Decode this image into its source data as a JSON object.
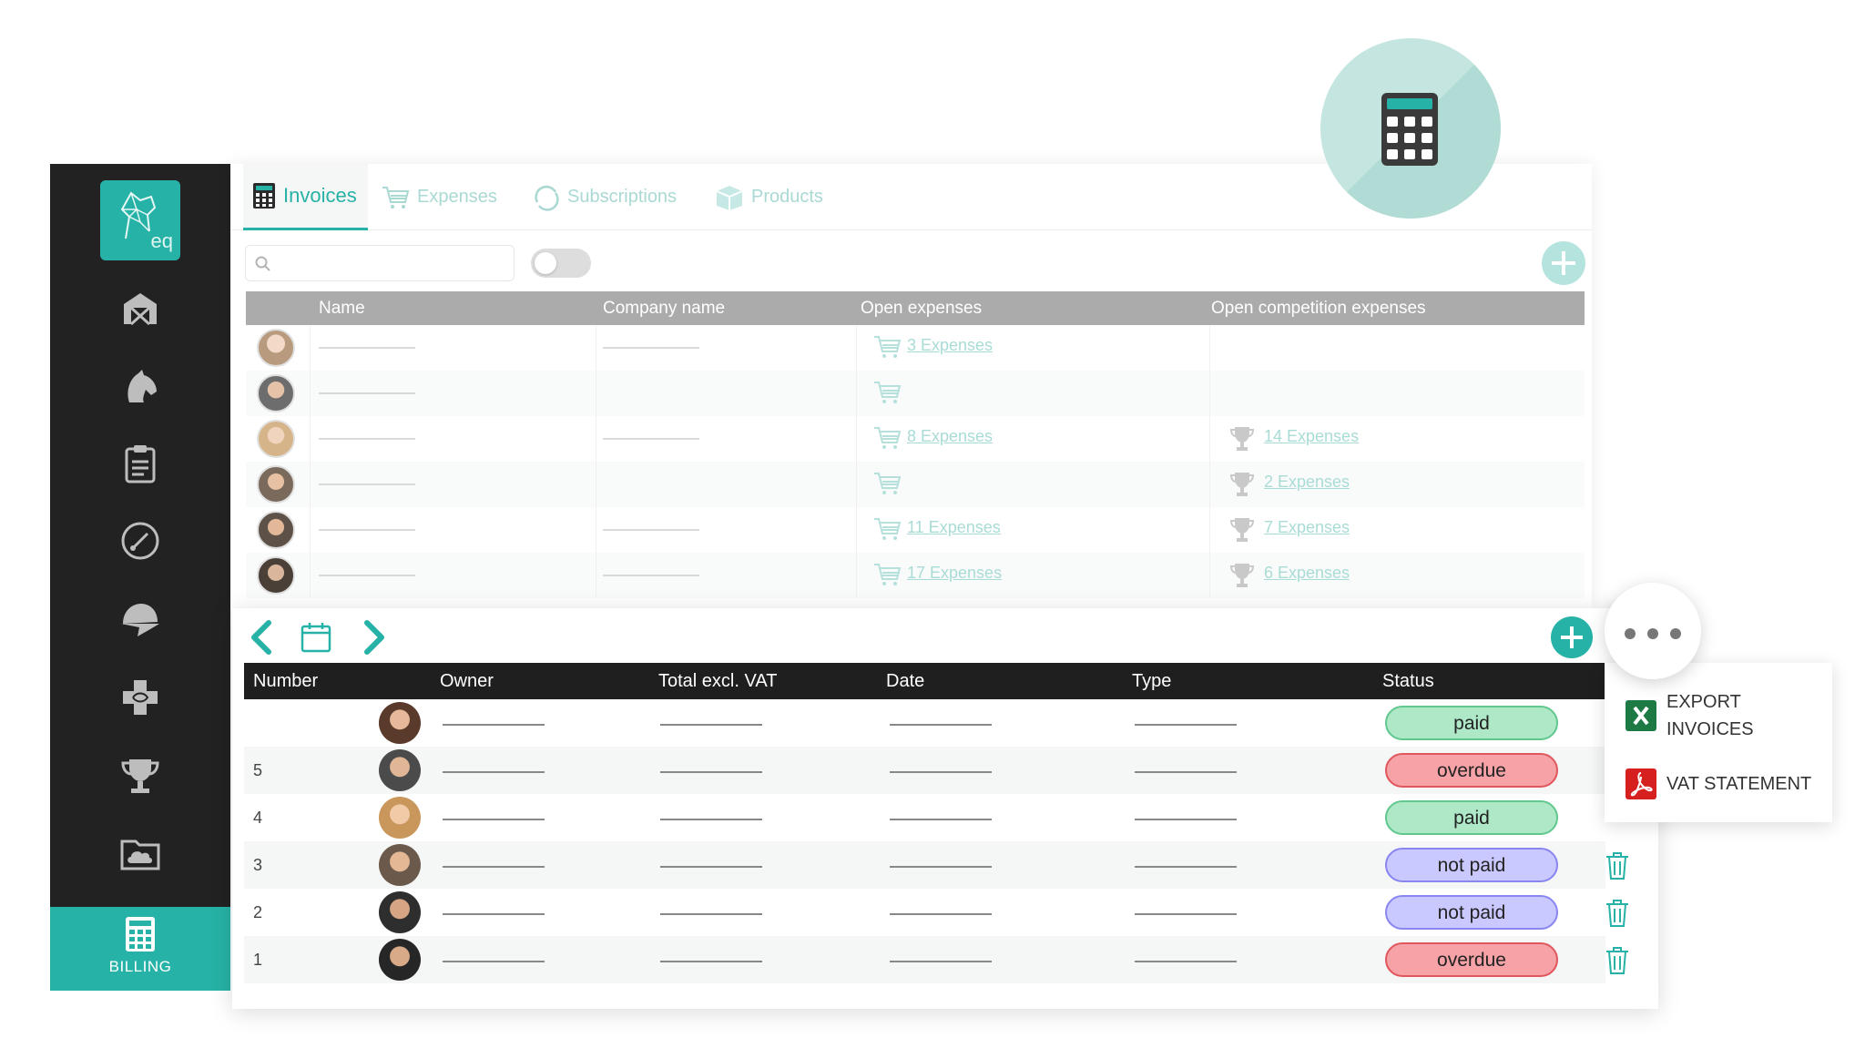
{
  "sidebar": {
    "logo_text": "eq",
    "items": [
      {
        "icon": "barn-icon"
      },
      {
        "icon": "horse-head-icon"
      },
      {
        "icon": "clipboard-icon"
      },
      {
        "icon": "gauge-icon"
      },
      {
        "icon": "riding-helmet-icon"
      },
      {
        "icon": "medical-cross-icon"
      },
      {
        "icon": "trophy-icon"
      },
      {
        "icon": "cloud-folder-icon"
      }
    ],
    "billing_label": "BILLING"
  },
  "tabs": {
    "invoices": "Invoices",
    "expenses": "Expenses",
    "subscriptions": "Subscriptions",
    "products": "Products"
  },
  "clients_table": {
    "headers": [
      "Name",
      "Company name",
      "Open expenses",
      "Open competition expenses"
    ],
    "rows": [
      {
        "open_expenses": "3 Expenses",
        "competition_expenses": ""
      },
      {
        "open_expenses": "",
        "competition_expenses": ""
      },
      {
        "open_expenses": "8 Expenses",
        "competition_expenses": "14 Expenses"
      },
      {
        "open_expenses": "",
        "competition_expenses": "2 Expenses"
      },
      {
        "open_expenses": "11 Expenses",
        "competition_expenses": "7 Expenses"
      },
      {
        "open_expenses": "17 Expenses",
        "competition_expenses": "6 Expenses"
      }
    ]
  },
  "invoices_table": {
    "headers": [
      "Number",
      "Owner",
      "Total excl. VAT",
      "Date",
      "Type",
      "Status"
    ],
    "rows": [
      {
        "number": "",
        "status": "paid"
      },
      {
        "number": "5",
        "status": "overdue"
      },
      {
        "number": "4",
        "status": "paid"
      },
      {
        "number": "3",
        "status": "not paid"
      },
      {
        "number": "2",
        "status": "not paid"
      },
      {
        "number": "1",
        "status": "overdue"
      }
    ]
  },
  "export_menu": {
    "export_invoices": "EXPORT\nINVOICES",
    "vat_statement": "VAT STATEMENT"
  },
  "colors": {
    "accent": "#26b2a6",
    "sidebar": "#222222",
    "paid": "#aee8c6",
    "overdue": "#f6a2a6",
    "not_paid": "#c9c8ff"
  }
}
